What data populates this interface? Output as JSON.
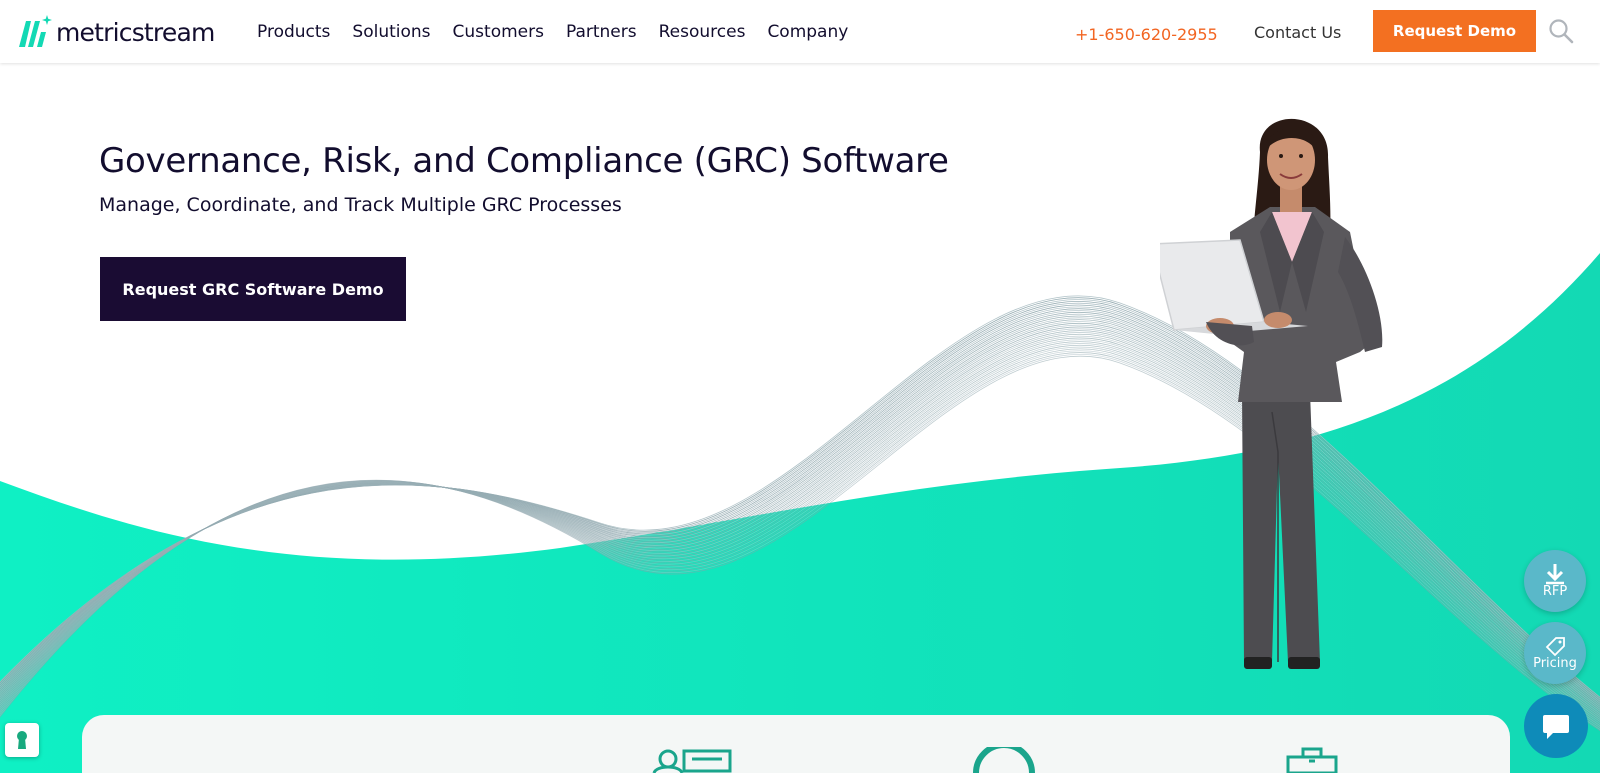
{
  "header": {
    "logo_text": "metricstream",
    "nav": [
      "Products",
      "Solutions",
      "Customers",
      "Partners",
      "Resources",
      "Company"
    ],
    "phone": "+1-650-620-2955",
    "contact": "Contact Us",
    "request_demo": "Request Demo"
  },
  "hero": {
    "title": "Governance, Risk, and Compliance (GRC) Software",
    "subtitle": "Manage, Coordinate, and Track Multiple GRC Processes",
    "cta": "Request GRC Software Demo"
  },
  "floating": {
    "rfp_label": "RFP",
    "pricing_label": "Pricing"
  },
  "colors": {
    "accent_orange": "#f37021",
    "phone_orange": "#f26522",
    "navy": "#1a0c33",
    "teal": "#11e8bf",
    "widget_blue": "#5ab8c9",
    "chat_blue": "#0e8bb9"
  },
  "icons": [
    "logo-mark-icon",
    "search-icon",
    "download-icon",
    "price-tag-icon",
    "chat-icon",
    "keyhole-icon",
    "id-card-icon",
    "gauge-icon",
    "briefcase-icon"
  ]
}
